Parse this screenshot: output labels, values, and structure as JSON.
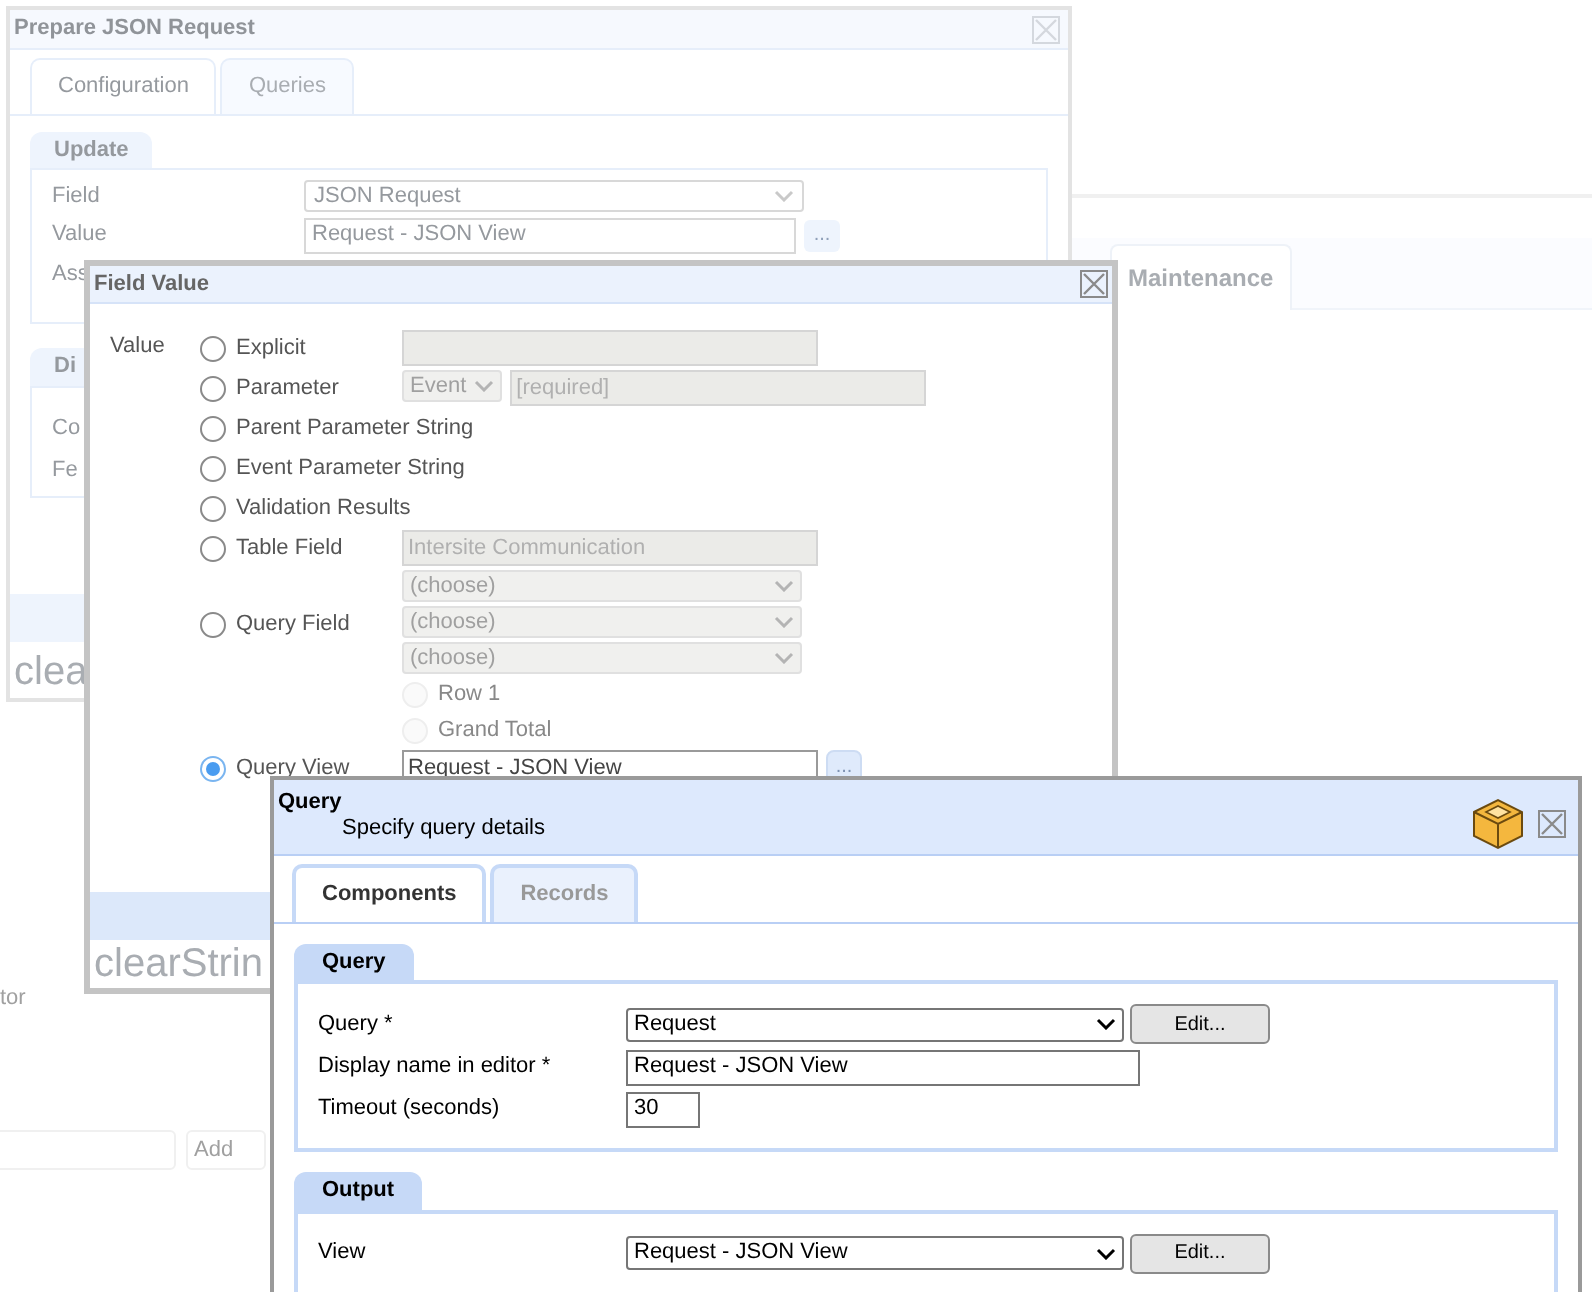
{
  "background": {
    "tab": "Maintenance",
    "side_label": "tor",
    "add_button": "Add"
  },
  "prepare_window": {
    "title": "Prepare JSON Request",
    "tabs": [
      {
        "label": "Configuration",
        "selected": true
      },
      {
        "label": "Queries",
        "selected": false
      }
    ],
    "update_section": {
      "title": "Update",
      "rows": [
        {
          "label": "Field",
          "kind": "select",
          "value": "JSON Request"
        },
        {
          "label": "Value",
          "kind": "text",
          "value": "Request - JSON View",
          "browse": "..."
        },
        {
          "label": "Ass",
          "kind": "covered"
        }
      ]
    },
    "second_section": {
      "title": "Di",
      "rows": [
        "Co",
        "Fe"
      ]
    },
    "footer_text": "clea"
  },
  "field_value_window": {
    "title": "Field Value",
    "label": "Value",
    "options": [
      {
        "label": "Explicit",
        "selected": false,
        "rows": [
          [
            {
              "kind": "input",
              "disabled": true
            }
          ]
        ]
      },
      {
        "label": "Parameter",
        "selected": false,
        "rows": [
          [
            {
              "kind": "select",
              "value": "Event",
              "disabled": true
            },
            {
              "kind": "input",
              "placeholder": "[required]",
              "disabled": true
            }
          ]
        ]
      },
      {
        "label": "Parent Parameter String",
        "selected": false
      },
      {
        "label": "Event Parameter String",
        "selected": false
      },
      {
        "label": "Validation Results",
        "selected": false
      },
      {
        "label": "Table Field",
        "selected": false,
        "rows": [
          [
            {
              "kind": "input",
              "value": "Intersite Communication",
              "disabled": true
            }
          ],
          [
            {
              "kind": "select",
              "value": "(choose)",
              "disabled": true
            }
          ]
        ]
      },
      {
        "label": "Query Field",
        "selected": false,
        "rows": [
          [
            {
              "kind": "select",
              "value": "(choose)",
              "disabled": true
            }
          ],
          [
            {
              "kind": "select",
              "value": "(choose)",
              "disabled": true
            }
          ]
        ],
        "sub_options": [
          {
            "label": "Row 1",
            "selected": false,
            "disabled": true
          },
          {
            "label": "Grand Total",
            "selected": false,
            "disabled": true
          }
        ]
      },
      {
        "label": "Query View",
        "selected": true,
        "rows": [
          [
            {
              "kind": "input",
              "value": "Request - JSON View",
              "disabled": false
            },
            {
              "kind": "browse",
              "value": "..."
            }
          ]
        ]
      }
    ],
    "footer_text": "clearStrin"
  },
  "query_window": {
    "title": "Query",
    "subtitle": "Specify query details",
    "tabs": [
      {
        "label": "Components",
        "selected": true
      },
      {
        "label": "Records",
        "selected": false
      }
    ],
    "sections": [
      {
        "title": "Query",
        "rows": [
          {
            "label": "Query *",
            "kind": "select",
            "value": "Request",
            "button": "Edit..."
          },
          {
            "label": "Display name in editor *",
            "kind": "text",
            "value": "Request - JSON View"
          },
          {
            "label": "Timeout (seconds)",
            "kind": "short_text",
            "value": "30"
          }
        ]
      },
      {
        "title": "Output",
        "rows": [
          {
            "label": "View",
            "kind": "select",
            "value": "Request - JSON View",
            "button": "Edit..."
          }
        ]
      }
    ]
  }
}
